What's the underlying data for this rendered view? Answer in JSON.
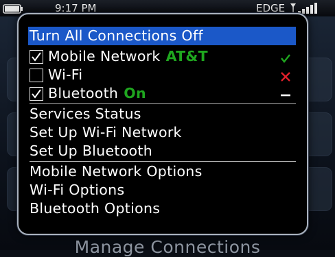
{
  "status_bar": {
    "time": "9:17 PM",
    "network": "EDGE",
    "icons": [
      "battery-icon",
      "signal-icon"
    ]
  },
  "background": {
    "caption": "Manage Connections"
  },
  "menu": {
    "turn_off_all": "Turn All Connections Off",
    "connections": [
      {
        "label": "Mobile Network",
        "status": "AT&T",
        "checked": true,
        "state_icon": "check-icon",
        "state_color": "#1fa61f"
      },
      {
        "label": "Wi-Fi",
        "status": "",
        "checked": false,
        "state_icon": "x-icon",
        "state_color": "#e0202a"
      },
      {
        "label": "Bluetooth",
        "status": "On",
        "checked": true,
        "state_icon": "dash-icon",
        "state_color": "#ffffff"
      }
    ],
    "services_status": "Services Status",
    "setup_wifi": "Set Up Wi-Fi Network",
    "setup_bluetooth": "Set Up Bluetooth",
    "mobile_network_options": "Mobile Network Options",
    "wifi_options": "Wi-Fi Options",
    "bluetooth_options": "Bluetooth Options"
  }
}
